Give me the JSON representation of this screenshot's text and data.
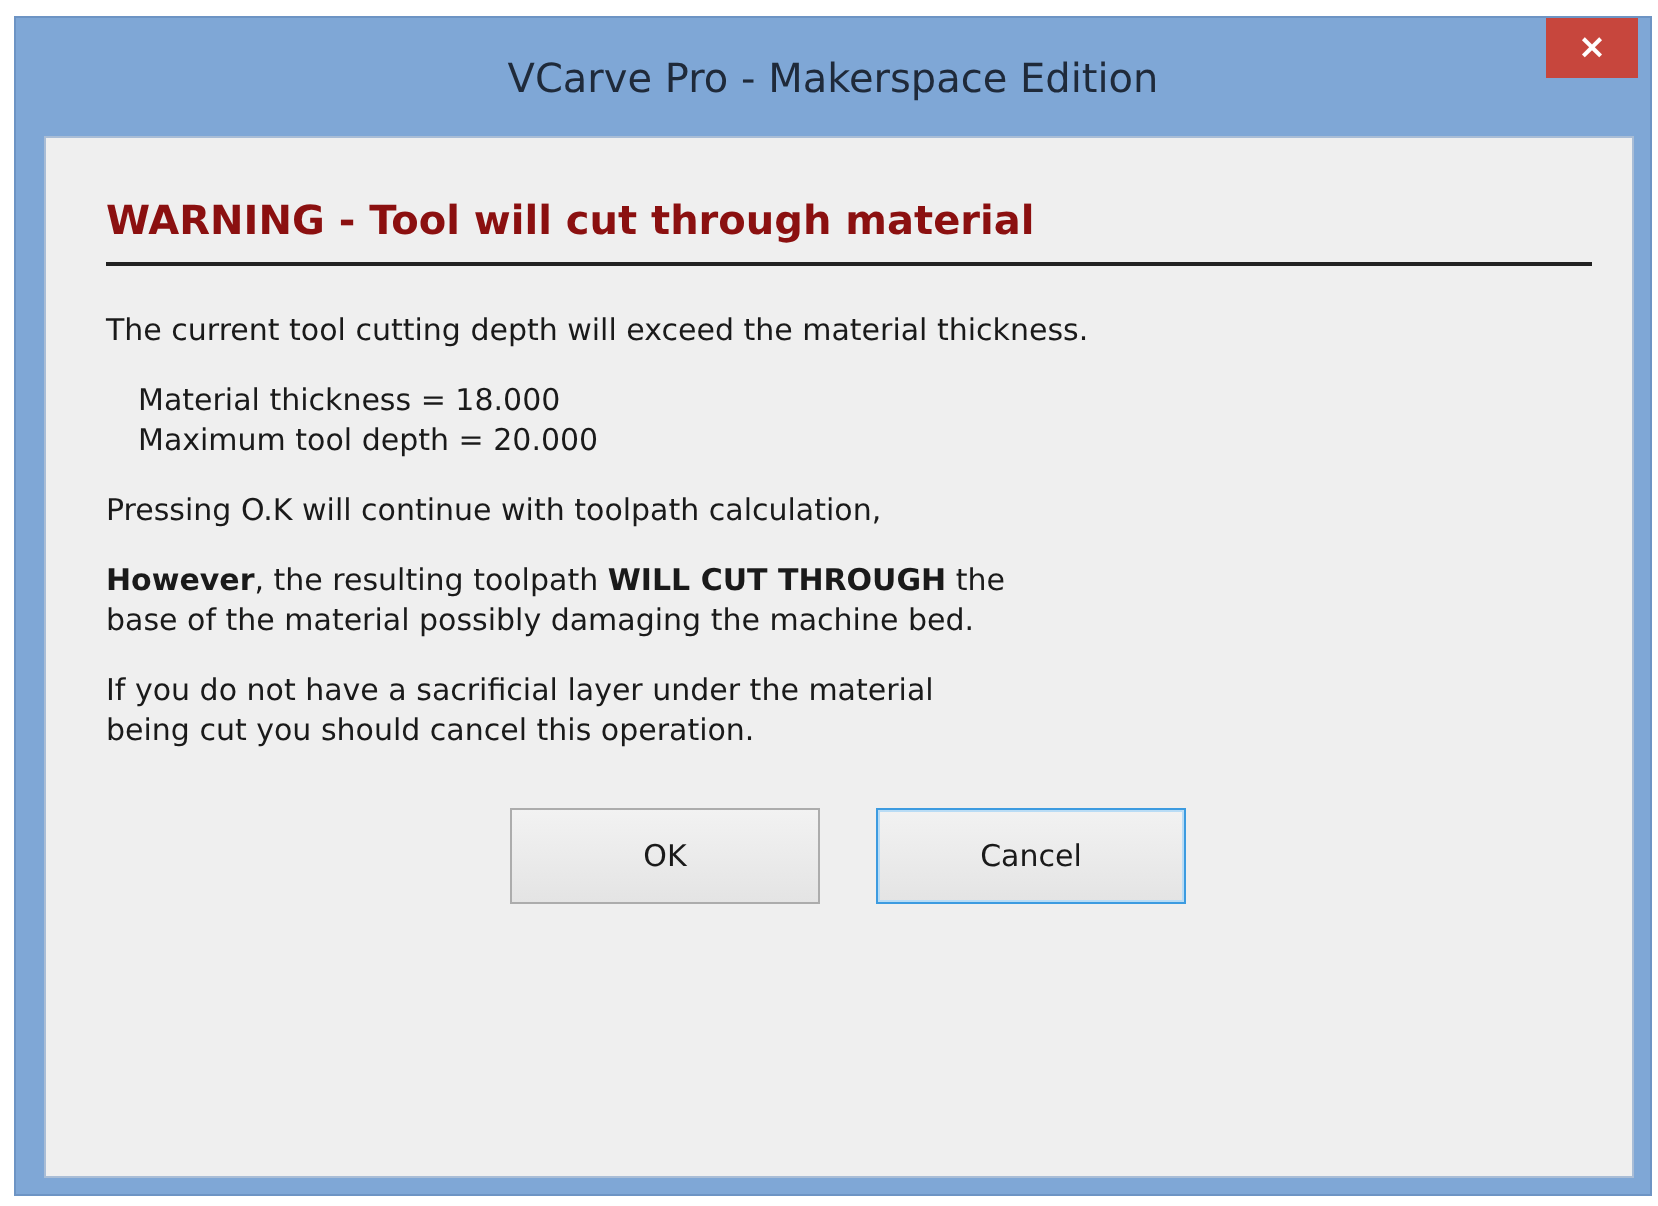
{
  "window": {
    "title": "VCarve Pro - Makerspace Edition",
    "close": "×"
  },
  "heading": "WARNING - Tool will cut through material",
  "paragraphs": [
    {
      "kind": "text",
      "lines": [
        "The current tool cutting depth will exceed the material thickness."
      ]
    },
    {
      "kind": "values",
      "lines": [
        "Material thickness = 18.000",
        "Maximum tool depth = 20.000"
      ]
    },
    {
      "kind": "text",
      "lines": [
        "Pressing O.K will continue with toolpath calculation,"
      ]
    },
    {
      "kind": "text",
      "lines": [
        "**However**, the resulting toolpath **WILL CUT THROUGH** the",
        "base of the material possibly damaging the machine bed."
      ]
    },
    {
      "kind": "text",
      "lines": [
        "If you do not have a sacrificial layer under the material",
        "being cut you should cancel this operation."
      ]
    }
  ],
  "buttons": [
    {
      "label": "OK",
      "focused": false
    },
    {
      "label": "Cancel",
      "focused": true
    }
  ]
}
